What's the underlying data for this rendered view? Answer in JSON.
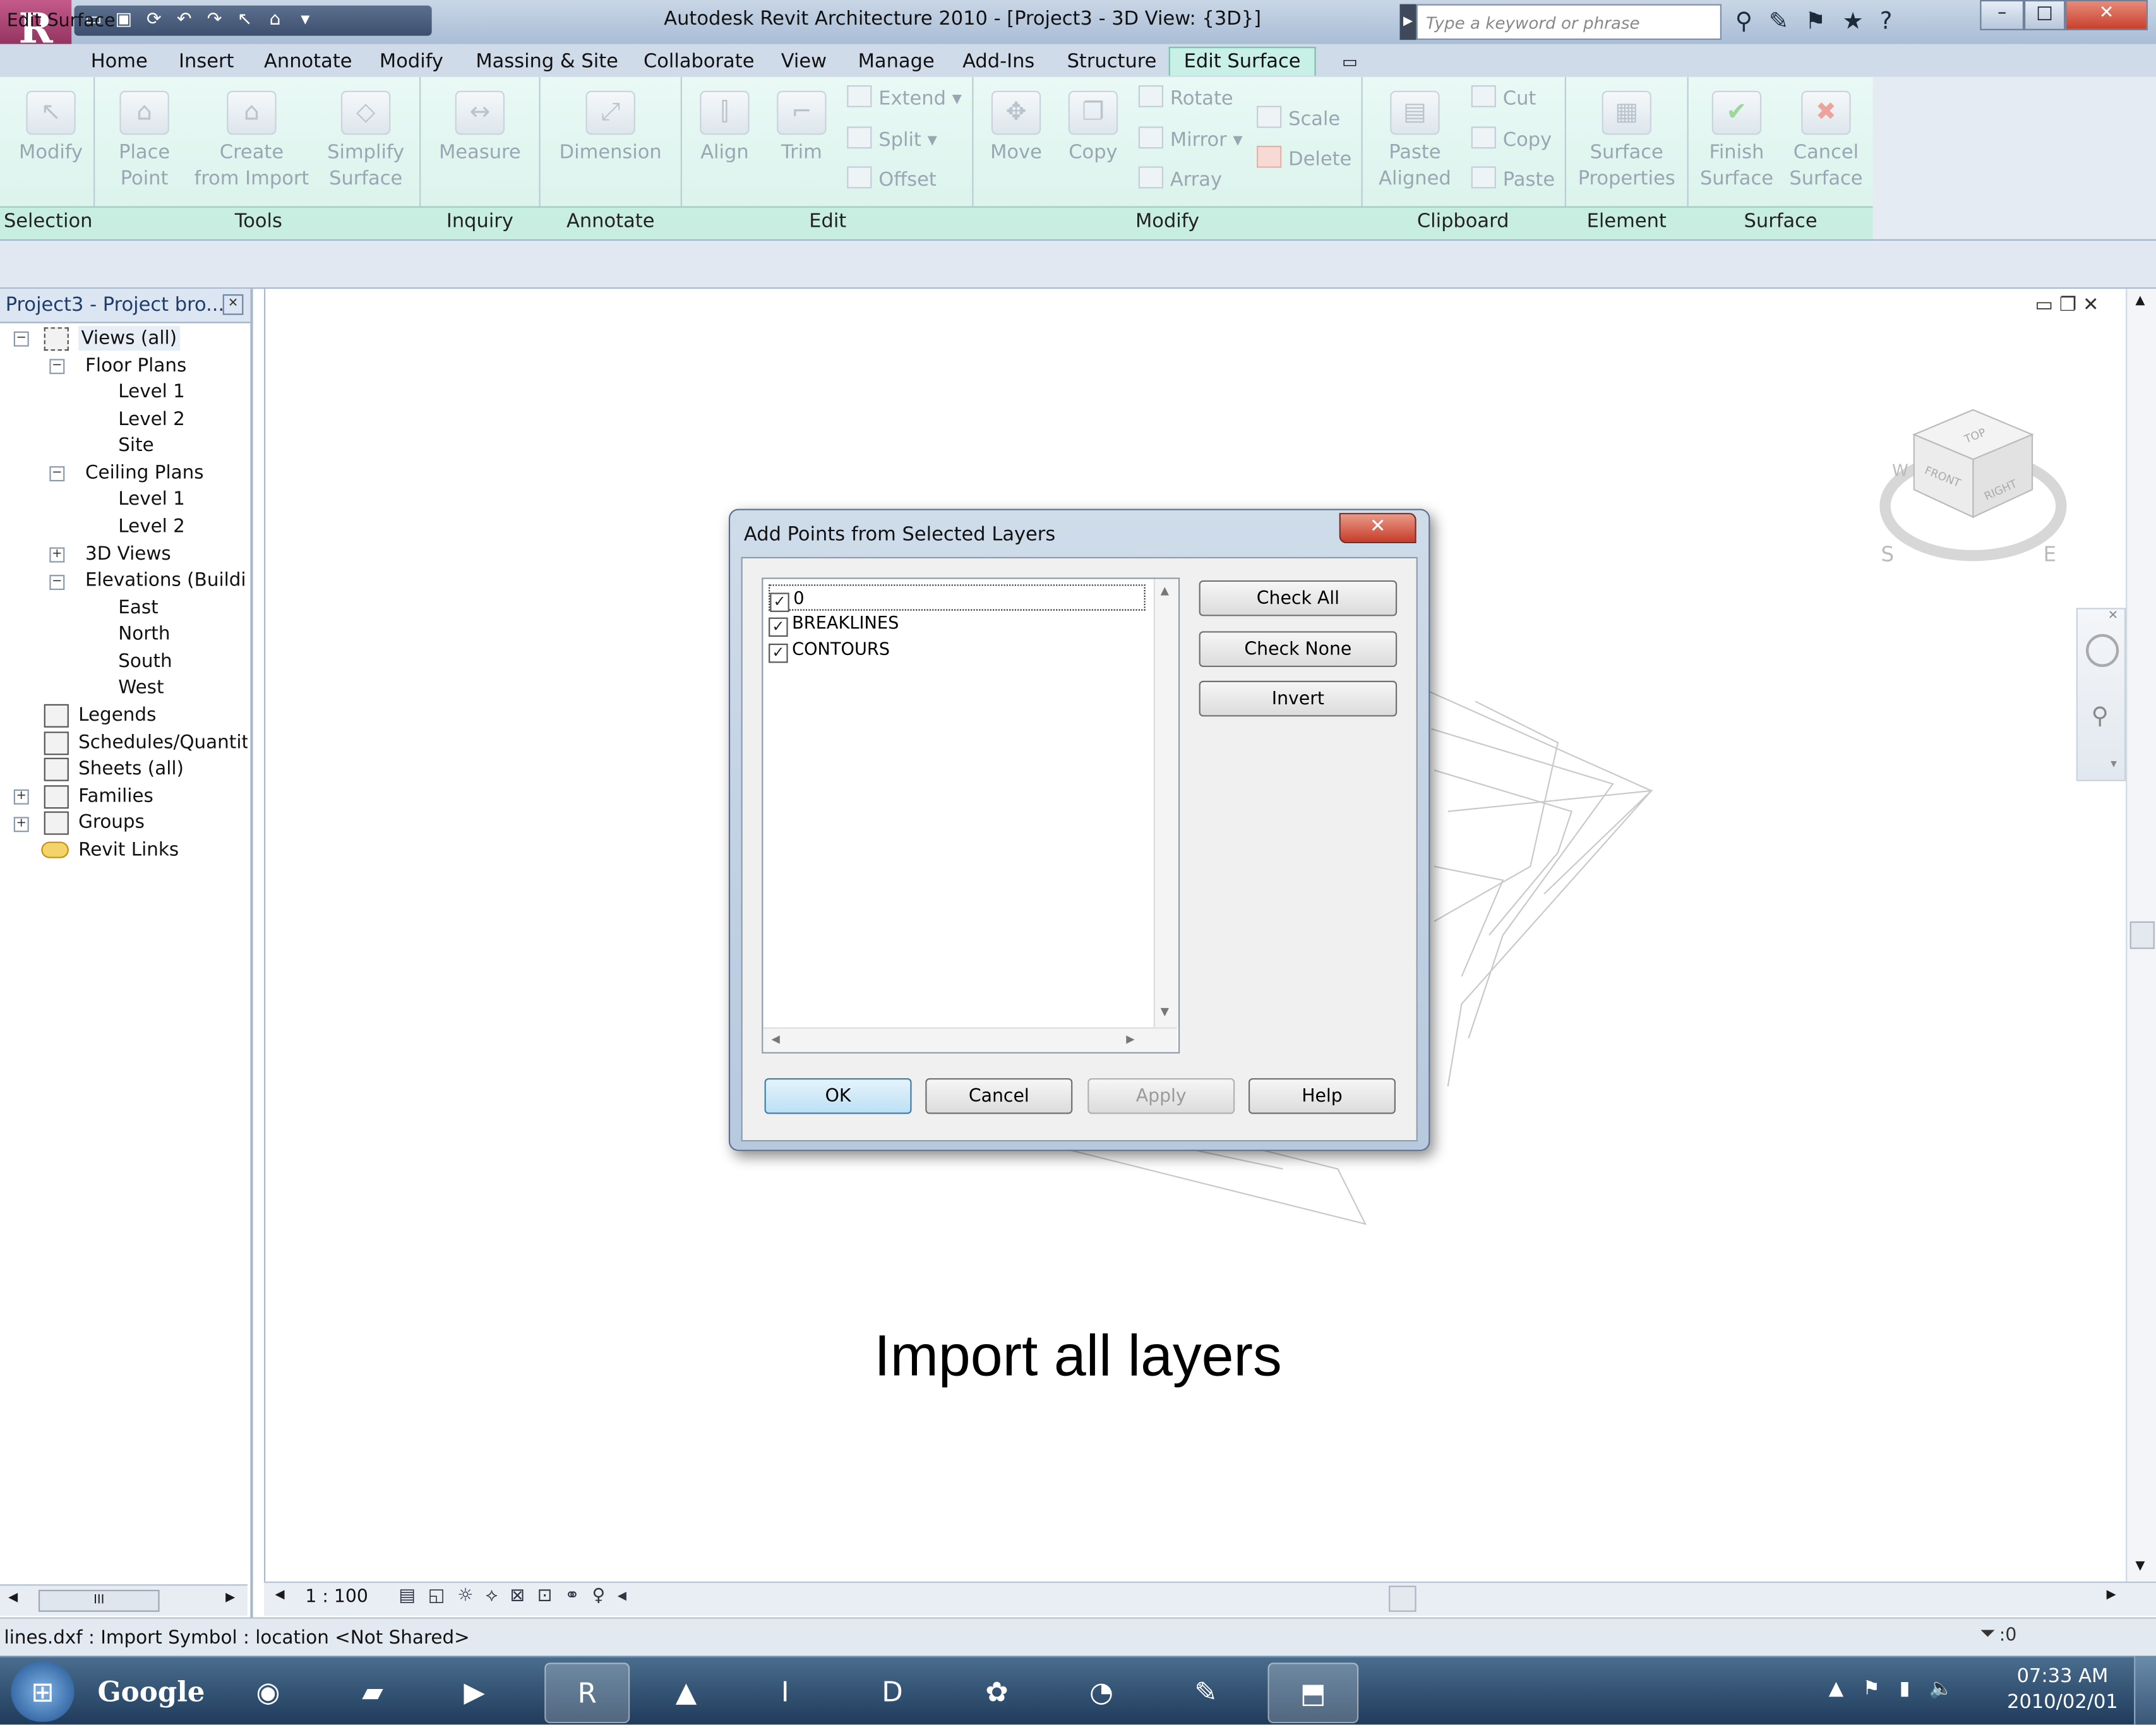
{
  "window": {
    "title": "Autodesk Revit Architecture 2010 - [Project3 - 3D View: {3D}]",
    "search_placeholder": "Type a keyword or phrase"
  },
  "ribbon_tabs": [
    "Home",
    "Insert",
    "Annotate",
    "Modify",
    "Massing & Site",
    "Collaborate",
    "View",
    "Manage",
    "Add-Ins",
    "Structure",
    "Edit Surface"
  ],
  "ribbon": {
    "modify": "Modify",
    "place_point": [
      "Place",
      "Point"
    ],
    "create_from_import": [
      "Create",
      "from Import"
    ],
    "simplify_surface": [
      "Simplify",
      "Surface"
    ],
    "measure": "Measure",
    "dimension": "Dimension",
    "align": "Align",
    "trim": "Trim",
    "extend": "Extend",
    "split": "Split",
    "offset": "Offset",
    "move": "Move",
    "copy": "Copy",
    "rotate": "Rotate",
    "mirror": "Mirror",
    "array": "Array",
    "scale": "Scale",
    "delete": "Delete",
    "paste_aligned": [
      "Paste",
      "Aligned"
    ],
    "cut": "Cut",
    "clip_copy": "Copy",
    "paste": "Paste",
    "surface_properties": [
      "Surface",
      "Properties"
    ],
    "finish_surface": [
      "Finish",
      "Surface"
    ],
    "cancel_surface": [
      "Cancel",
      "Surface"
    ],
    "panels": [
      "Selection",
      "Tools",
      "Inquiry",
      "Annotate",
      "Edit",
      "Modify",
      "Clipboard",
      "Element",
      "Surface"
    ]
  },
  "options_bar": {
    "label": "Edit Surface"
  },
  "project_browser": {
    "title": "Project3 - Project bro...",
    "views_all": "Views (all)",
    "floor_plans": "Floor Plans",
    "fp_level1": "Level 1",
    "fp_level2": "Level 2",
    "fp_site": "Site",
    "ceiling_plans": "Ceiling Plans",
    "cp_level1": "Level 1",
    "cp_level2": "Level 2",
    "views_3d": "3D Views",
    "elevations": "Elevations (Building",
    "el_east": "East",
    "el_north": "North",
    "el_south": "South",
    "el_west": "West",
    "legends": "Legends",
    "schedules": "Schedules/Quantitie",
    "sheets": "Sheets (all)",
    "families": "Families",
    "groups": "Groups",
    "revit_links": "Revit Links",
    "scroll_thumb": "III"
  },
  "viewcube": {
    "top": "TOP",
    "front": "FRONT",
    "right": "RIGHT",
    "south": "S",
    "east": "E",
    "west": "W"
  },
  "view_bar": {
    "scale": "1 : 100"
  },
  "dialog": {
    "title": "Add Points from Selected Layers",
    "layers": [
      {
        "name": "0",
        "checked": true
      },
      {
        "name": "BREAKLINES",
        "checked": true
      },
      {
        "name": "CONTOURS",
        "checked": true
      }
    ],
    "check_all": "Check All",
    "check_none": "Check None",
    "invert": "Invert",
    "ok": "OK",
    "cancel": "Cancel",
    "apply": "Apply",
    "help": "Help"
  },
  "caption": "Import all layers",
  "status_bar": {
    "text": "lines.dxf : Import Symbol : location <Not Shared>",
    "filter_count": ":0"
  },
  "taskbar": {
    "google": "Google",
    "time": "07:33 AM",
    "date": "2010/02/01"
  },
  "colors": {
    "active_tab": "#c9f0e6",
    "dialog_close": "#c63d2a",
    "taskbar": "#1f3a5a"
  }
}
